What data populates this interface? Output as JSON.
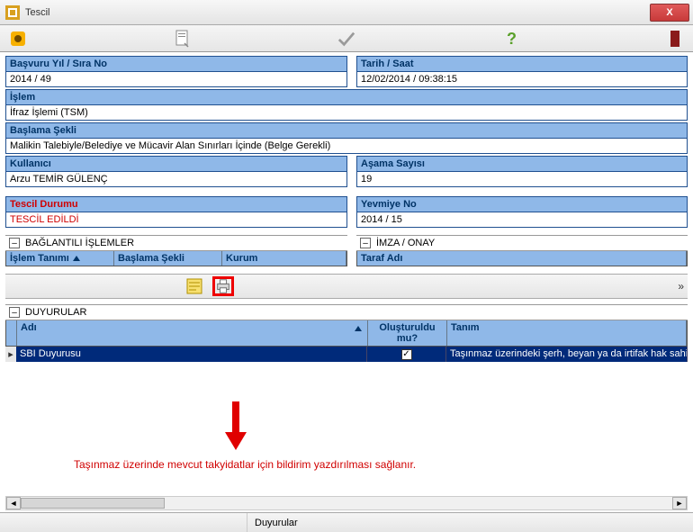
{
  "window": {
    "title": "Tescil",
    "close": "X"
  },
  "fields": {
    "basvuru_label": "Başvuru Yıl / Sıra No",
    "basvuru_value": "2014 / 49",
    "tarih_label": "Tarih / Saat",
    "tarih_value": "12/02/2014 / 09:38:15",
    "islem_label": "İşlem",
    "islem_value": "İfraz İşlemi (TSM)",
    "baslama_label": "Başlama Şekli",
    "baslama_value": "Malikin Talebiyle/Belediye ve Mücavir Alan Sınırları İçinde (Belge Gerekli)",
    "kullanici_label": "Kullanıcı",
    "kullanici_value": "Arzu TEMİR GÜLENÇ",
    "asama_label": "Aşama Sayısı",
    "asama_value": "19",
    "tescil_label": "Tescil Durumu",
    "tescil_value": "TESCİL EDİLDİ",
    "yevmiye_label": "Yevmiye No",
    "yevmiye_value": "2014 / 15"
  },
  "baglantili": {
    "title": "BAĞLANTILI İŞLEMLER",
    "col_islem": "İşlem Tanımı",
    "col_baslama": "Başlama Şekli",
    "col_kurum": "Kurum"
  },
  "imza": {
    "title": "İMZA / ONAY",
    "col_taraf": "Taraf Adı"
  },
  "duyurular": {
    "title": "DUYURULAR",
    "col_adi": "Adı",
    "col_olusturuldu": "Oluşturuldu mu?",
    "col_tanim": "Tanım",
    "row_adi": "SBI Duyurusu",
    "row_check": "✓",
    "row_tanim": "Taşınmaz üzerindeki şerh, beyan ya da irtifak hak sahiple"
  },
  "annotation": {
    "text": "Taşınmaz üzerinde mevcut takyidatlar için bildirim yazdırılması sağlanır."
  },
  "statusbar": {
    "tab": "Duyurular"
  }
}
